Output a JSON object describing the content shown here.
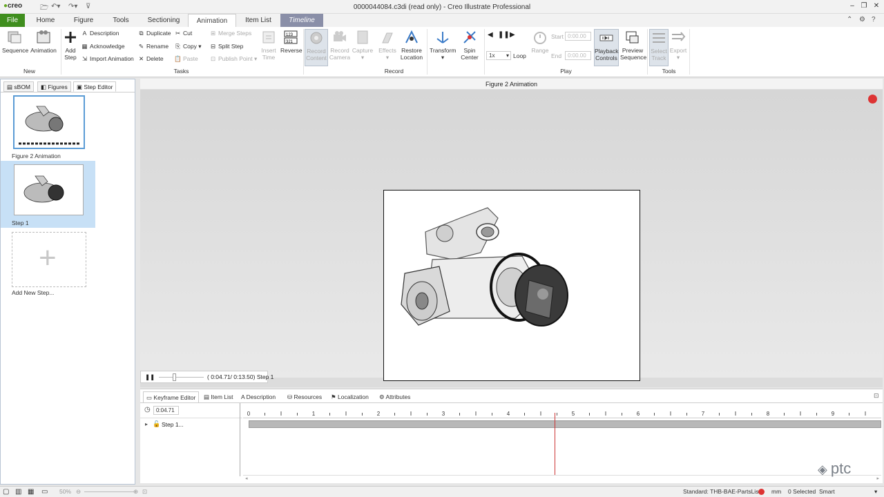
{
  "app": {
    "logo": "creo",
    "title": "0000044084.c3di (read only) - Creo Illustrate Professional"
  },
  "tabs": [
    "File",
    "Home",
    "Figure",
    "Tools",
    "Sectioning",
    "Animation",
    "Item List",
    "Timeline"
  ],
  "ribbon": {
    "new": {
      "sequence": "Sequence",
      "animation": "Animation",
      "group": "New"
    },
    "tasks": {
      "add_step": "Add Step",
      "description": "Description",
      "acknowledge": "Acknowledge",
      "import_animation": "Import Animation",
      "duplicate": "Duplicate",
      "rename": "Rename",
      "delete": "Delete",
      "cut": "Cut",
      "copy": "Copy",
      "paste": "Paste",
      "merge_steps": "Merge Steps",
      "split_step": "Split Step",
      "publish_point": "Publish Point",
      "insert_time": "Insert Time",
      "reverse": "Reverse",
      "group": "Tasks"
    },
    "record": {
      "record_content": "Record Content",
      "record_camera": "Record Camera",
      "capture": "Capture",
      "effects": "Effects",
      "restore_location": "Restore Location",
      "transform": "Transform",
      "spin_center": "Spin Center",
      "group": "Record"
    },
    "play": {
      "speed": "1x",
      "loop": "Loop",
      "range": "Range",
      "start": "Start",
      "end": "End",
      "start_val": "0:00.00",
      "end_val": "0:00.00",
      "playback_controls": "Playback Controls",
      "preview_sequence": "Preview Sequence",
      "group": "Play"
    },
    "tools": {
      "select_track": "Select Track",
      "export": "Export",
      "group": "Tools"
    }
  },
  "left_panel": {
    "tabs": [
      "sBOM",
      "Figures",
      "Step Editor"
    ],
    "items": [
      "Figure 2 Animation",
      "Step 1",
      "Add New Step..."
    ]
  },
  "viewport": {
    "title": "Figure 2 Animation",
    "playback_time": "( 0:04.71/ 0:13.50)  Step 1"
  },
  "keyframe": {
    "tabs": [
      "Keyframe Editor",
      "Item List",
      "Description",
      "Resources",
      "Localization",
      "Attributes"
    ],
    "current_time": "0:04.71",
    "row_label": "Step 1...",
    "ticks": [
      "0",
      "1",
      "2",
      "3",
      "4",
      "5",
      "6",
      "7",
      "8",
      "9"
    ]
  },
  "status": {
    "standard": "Standard: THB-BAE-PartsList",
    "units": "mm",
    "selected": "0 Selected",
    "mode": "Smart",
    "zoom": "50%"
  },
  "watermark": "ptc",
  "colors": {
    "file_tab": "#3f8e1e",
    "timeline_tab": "#8a8fa8",
    "record": "#d33333",
    "accent": "#5a9bd5"
  }
}
